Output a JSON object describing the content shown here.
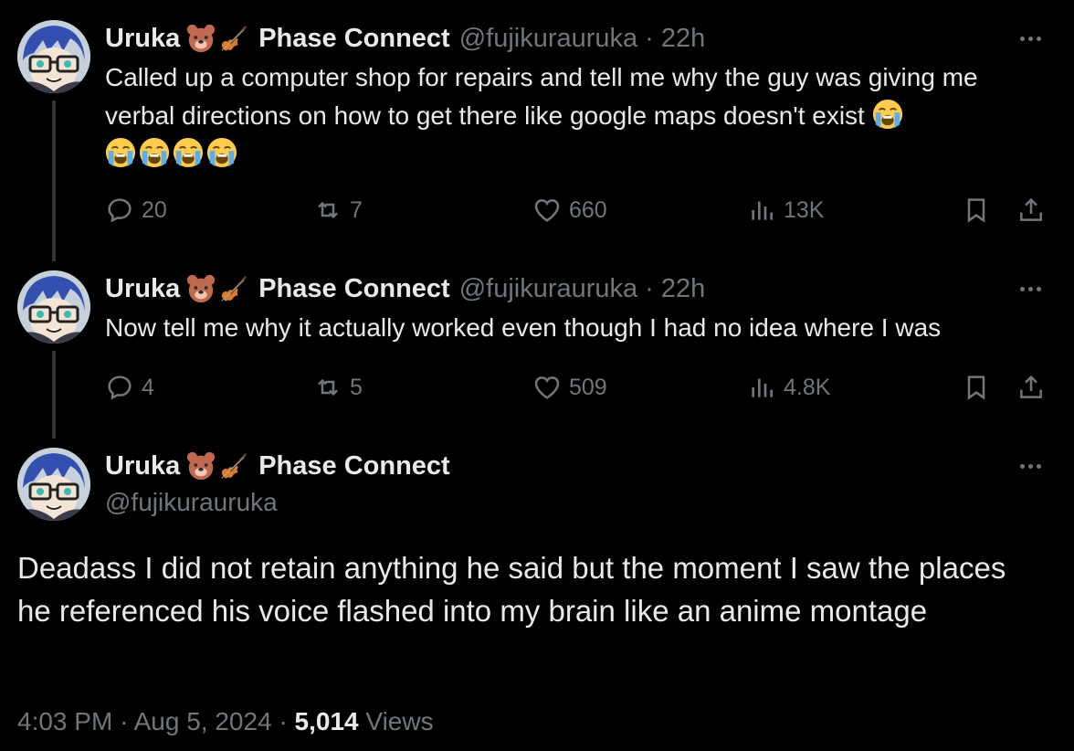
{
  "author": {
    "name": "Uruka",
    "affiliation": "Phase Connect",
    "handle": "@fujikurauruka",
    "emoji_icons": [
      "bear-face-icon",
      "violin-icon"
    ]
  },
  "replies": [
    {
      "time": "22h",
      "text": "Called up a computer shop for repairs and tell me why the guy was giving me verbal directions on how to get there like google maps doesn't exist",
      "trailing_emoji": "loudly-crying-face-icon",
      "trailing_emoji_count": 5,
      "stats": {
        "replies": "20",
        "reposts": "7",
        "likes": "660",
        "views": "13K"
      }
    },
    {
      "time": "22h",
      "text": "Now tell me why it actually worked even though I had no idea where I was",
      "stats": {
        "replies": "4",
        "reposts": "5",
        "likes": "509",
        "views": "4.8K"
      }
    }
  ],
  "main_post": {
    "text": "Deadass I did not retain anything he said but the moment I saw the places he referenced his voice flashed into my brain like an anime montage",
    "time": "4:03 PM",
    "date": "Aug 5, 2024",
    "views_count": "5,014",
    "views_label": "Views"
  },
  "dot": "·",
  "colors": {
    "background": "#000000",
    "text": "#e7e9ea",
    "muted": "#71767b",
    "thread_line": "#333639"
  }
}
